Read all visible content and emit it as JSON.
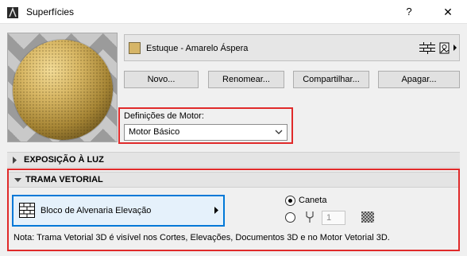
{
  "window": {
    "title": "Superfícies",
    "help_label": "?",
    "close_label": "✕"
  },
  "surface": {
    "name": "Estuque - Amarelo Áspera",
    "swatch_color": "#d6b567"
  },
  "buttons": {
    "new": "Novo...",
    "rename": "Renomear...",
    "share": "Compartilhar...",
    "delete": "Apagar..."
  },
  "engine": {
    "label": "Definições de Motor:",
    "value": "Motor Básico"
  },
  "sections": {
    "light": "EXPOSIÇÃO À LUZ",
    "vector": "TRAMA VETORIAL"
  },
  "vector_fill": {
    "name": "Bloco de Alvenaria Elevação",
    "pen_option_label": "Caneta",
    "pen_number": "1",
    "note": "Nota: Trama Vetorial 3D é visível nos Cortes, Elevações, Documentos 3D e no Motor Vetorial 3D."
  },
  "colors": {
    "highlight_border": "#e02a2a",
    "selected_border": "#0078d7"
  },
  "icons": [
    "app-icon",
    "brick-pattern-icon",
    "texture-icon",
    "chevron-right-icon",
    "chevron-down-icon",
    "pen-icon",
    "pen-swatch-icon"
  ]
}
